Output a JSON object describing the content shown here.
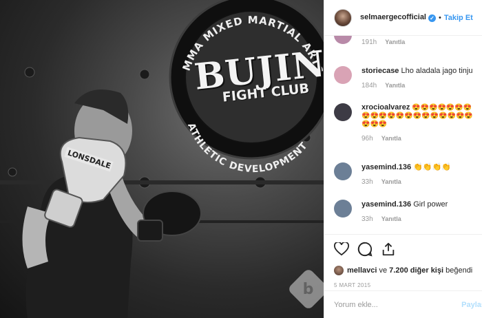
{
  "photo": {
    "sign_arc_top": "MMA MIXED MARTIAL ARTS",
    "sign_main": "BUJIN",
    "sign_sub": "FIGHT CLUB",
    "sign_arc_bottom": "ATHLETIC DEVELOPMENT",
    "glove_brand": "LONSDALE",
    "watermark": "b"
  },
  "header": {
    "username": "selmaergecofficial",
    "verified_icon": "verified-badge-icon",
    "separator": "•",
    "follow_label": "Takip Et"
  },
  "comments": [
    {
      "user": "",
      "text": "",
      "time": "191h",
      "reply": "Yanıtla",
      "avatar_color": "#b88aa8"
    },
    {
      "user": "storiecase",
      "text": "Lho aladala jago tinju",
      "time": "184h",
      "reply": "Yanıtla",
      "avatar_color": "#d9a3b5"
    },
    {
      "user": "xrocioalvarez",
      "text": "😍😍😍😍😍😍😍😍😍😍😍😍😍😍😍😍😍😍😍😍😍😍😍",
      "time": "96h",
      "reply": "Yanıtla",
      "avatar_color": "#3d3b45"
    },
    {
      "user": "yasemind.136",
      "text": "👏👏👏👏",
      "time": "33h",
      "reply": "Yanıtla",
      "avatar_color": "#6c7f96"
    },
    {
      "user": "yasemind.136",
      "text": "Girl power",
      "time": "33h",
      "reply": "Yanıtla",
      "avatar_color": "#6c7f96"
    }
  ],
  "actions": {
    "icons": [
      "heart-icon",
      "comment-icon",
      "share-icon"
    ]
  },
  "likes": {
    "first_user": "mellavci",
    "text": " ve ",
    "others": "7.200 diğer kişi",
    "suffix": " beğendi"
  },
  "date": "5 MART 2015",
  "add_comment": {
    "placeholder": "Yorum ekle...",
    "post_label": "Paylaş"
  },
  "colors": {
    "accent": "#3897f0",
    "muted": "#999999",
    "border": "#efefef"
  }
}
